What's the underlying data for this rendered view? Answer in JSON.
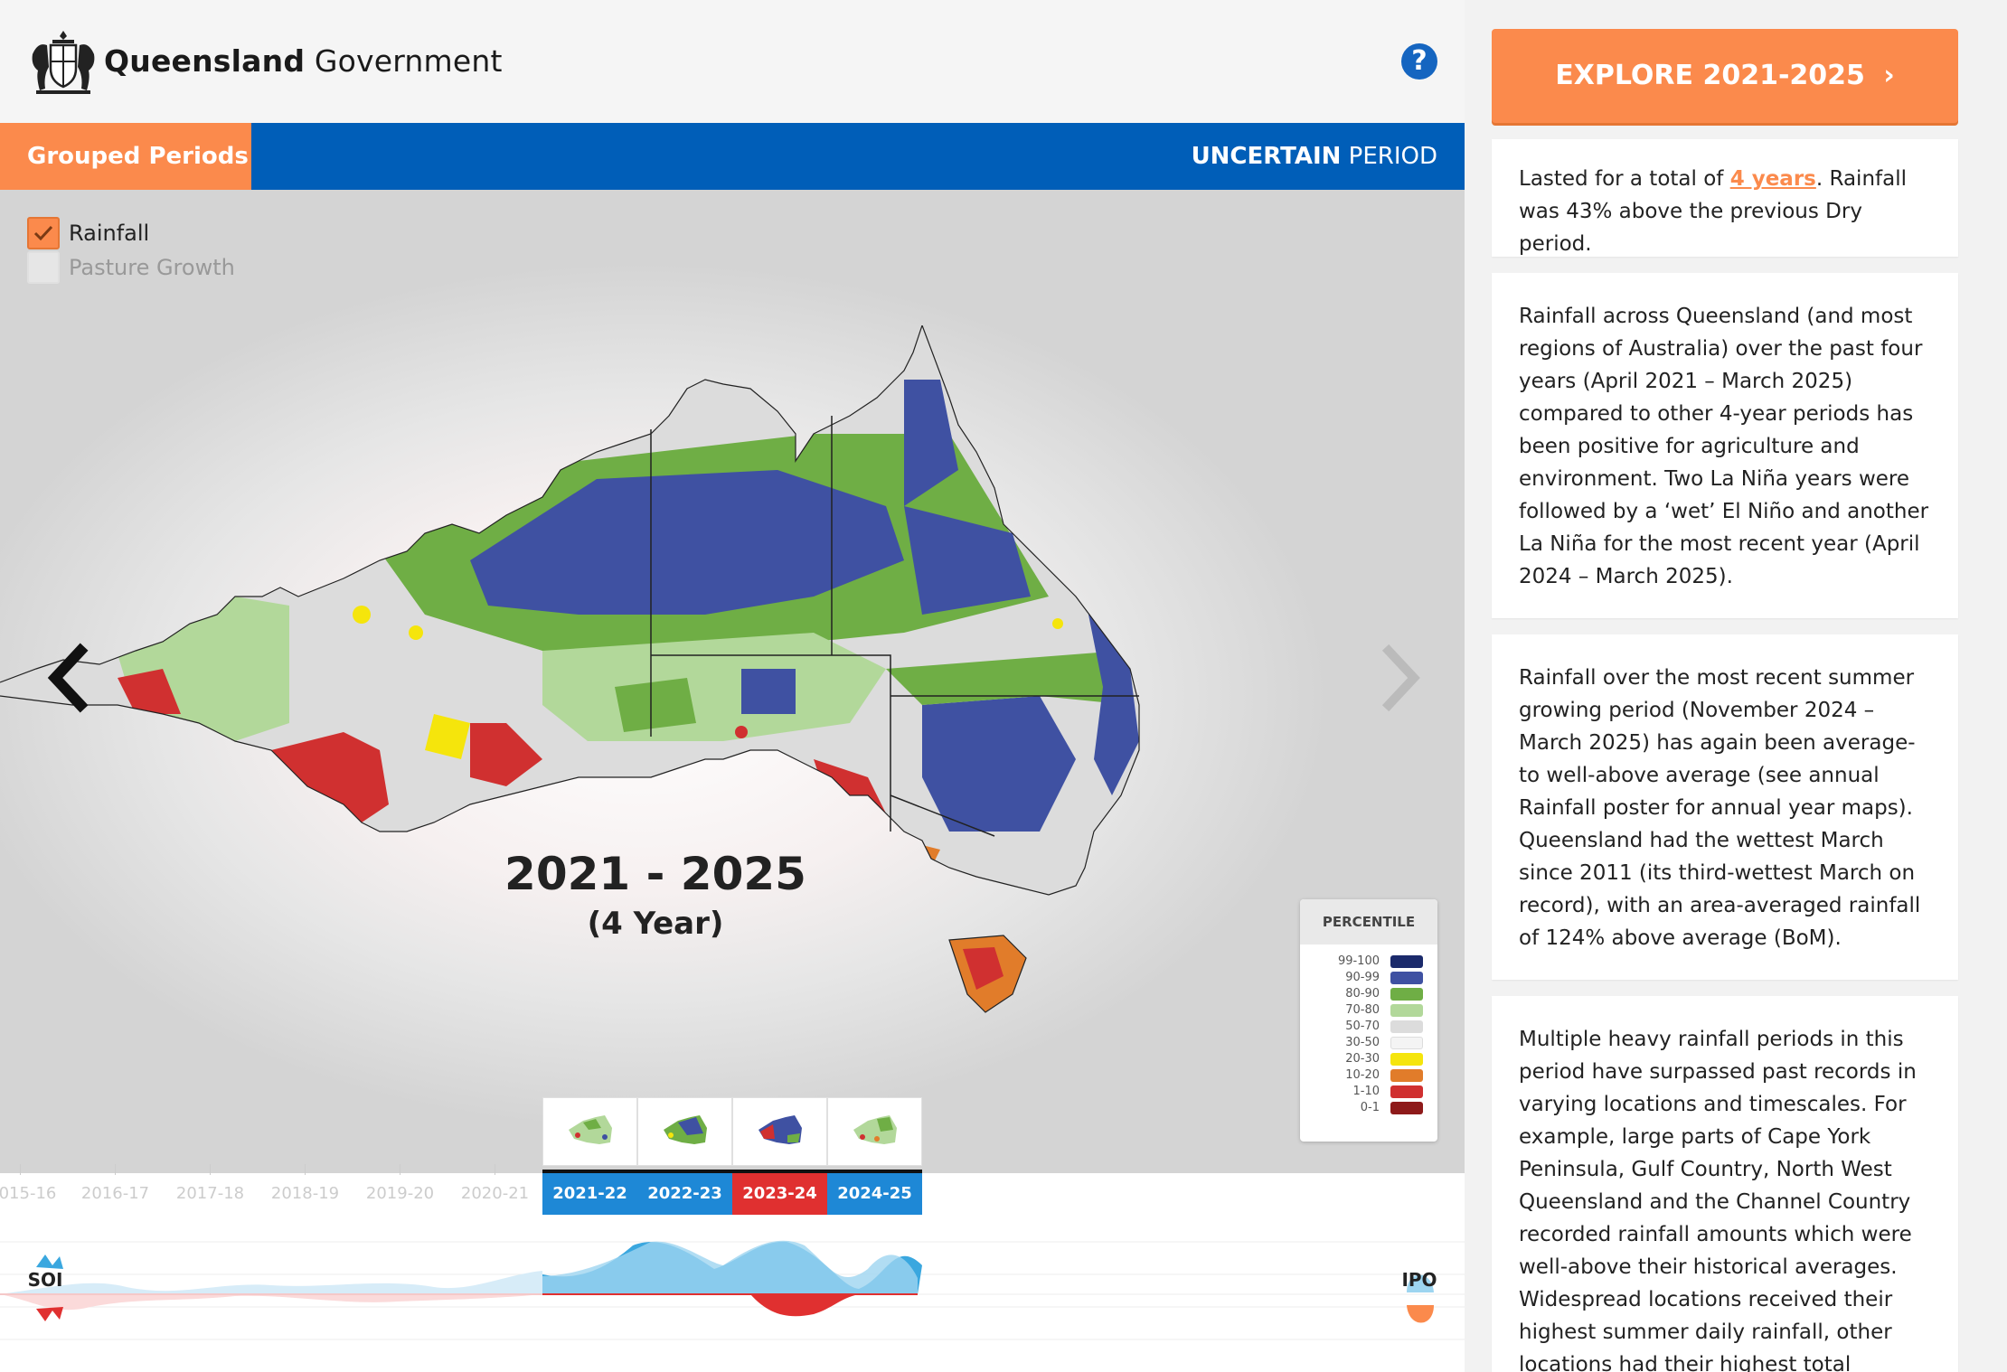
{
  "header": {
    "brand_bold": "Queensland",
    "brand_regular": " Government",
    "help_symbol": "?"
  },
  "tabs": {
    "grouped_periods": "Grouped Periods",
    "period_bold": "UNCERTAIN",
    "period_rest": " PERIOD"
  },
  "layers": {
    "rainfall": "Rainfall",
    "pasture": "Pasture Growth"
  },
  "map": {
    "title": "2021 - 2025",
    "subtitle": "(4 Year)",
    "prev_icon": "chevron-left-icon",
    "next_icon": "chevron-right-icon"
  },
  "legend": {
    "title": "PERCENTILE",
    "items": [
      {
        "label": "99-100",
        "color": "#1b2a6b"
      },
      {
        "label": "90-99",
        "color": "#3f51a2"
      },
      {
        "label": "80-90",
        "color": "#6fae45"
      },
      {
        "label": "70-80",
        "color": "#b2d89a"
      },
      {
        "label": "50-70",
        "color": "#dcdcdc"
      },
      {
        "label": "30-50",
        "color": "#f4f4f4"
      },
      {
        "label": "20-30",
        "color": "#f5e50c"
      },
      {
        "label": "10-20",
        "color": "#e17c2a"
      },
      {
        "label": "1-10",
        "color": "#d03030"
      },
      {
        "label": "0-1",
        "color": "#8e1a1a"
      }
    ]
  },
  "timeline": {
    "past_years": [
      "015-16",
      "2016-17",
      "2017-18",
      "2018-19",
      "2019-20",
      "2020-21"
    ],
    "current_years": [
      {
        "label": "2021-22",
        "color": "#1e88d6"
      },
      {
        "label": "2022-23",
        "color": "#1e88d6"
      },
      {
        "label": "2023-24",
        "color": "#e03030"
      },
      {
        "label": "2024-25",
        "color": "#1e88d6"
      }
    ],
    "soi_label": "SOI",
    "ipo_label": "IPO"
  },
  "sidebar": {
    "explore_label": "EXPLORE 2021-2025",
    "explore_arrow": "›",
    "card1_pre": "Lasted for a total of ",
    "card1_link": "4 years",
    "card1_post": ". Rainfall was 43% above the previous Dry period.",
    "card2": "Rainfall across Queensland (and most regions of Australia) over the past four years (April 2021 – March 2025) compared to other 4-year periods has been positive for agriculture and environment. Two La Niña years were followed by a ‘wet’ El Niño and another La Niña for the most recent year (April 2024 – March 2025).",
    "card3": "Rainfall over the most recent summer growing period (November 2024 – March 2025) has again been average- to well-above average (see annual Rainfall poster for annual year maps). Queensland had the wettest March since 2011 (its third-wettest March on record), with an area-averaged rainfall of 124% above average (BoM).",
    "card4": "Multiple heavy rainfall periods in this period have surpassed past records in varying locations and timescales. For example, large parts of Cape York Peninsula, Gulf Country, North West Queensland and the Channel Country recorded rainfall amounts which were well-above their historical averages. Widespread locations received their highest summer daily rainfall, other locations had their highest total"
  }
}
